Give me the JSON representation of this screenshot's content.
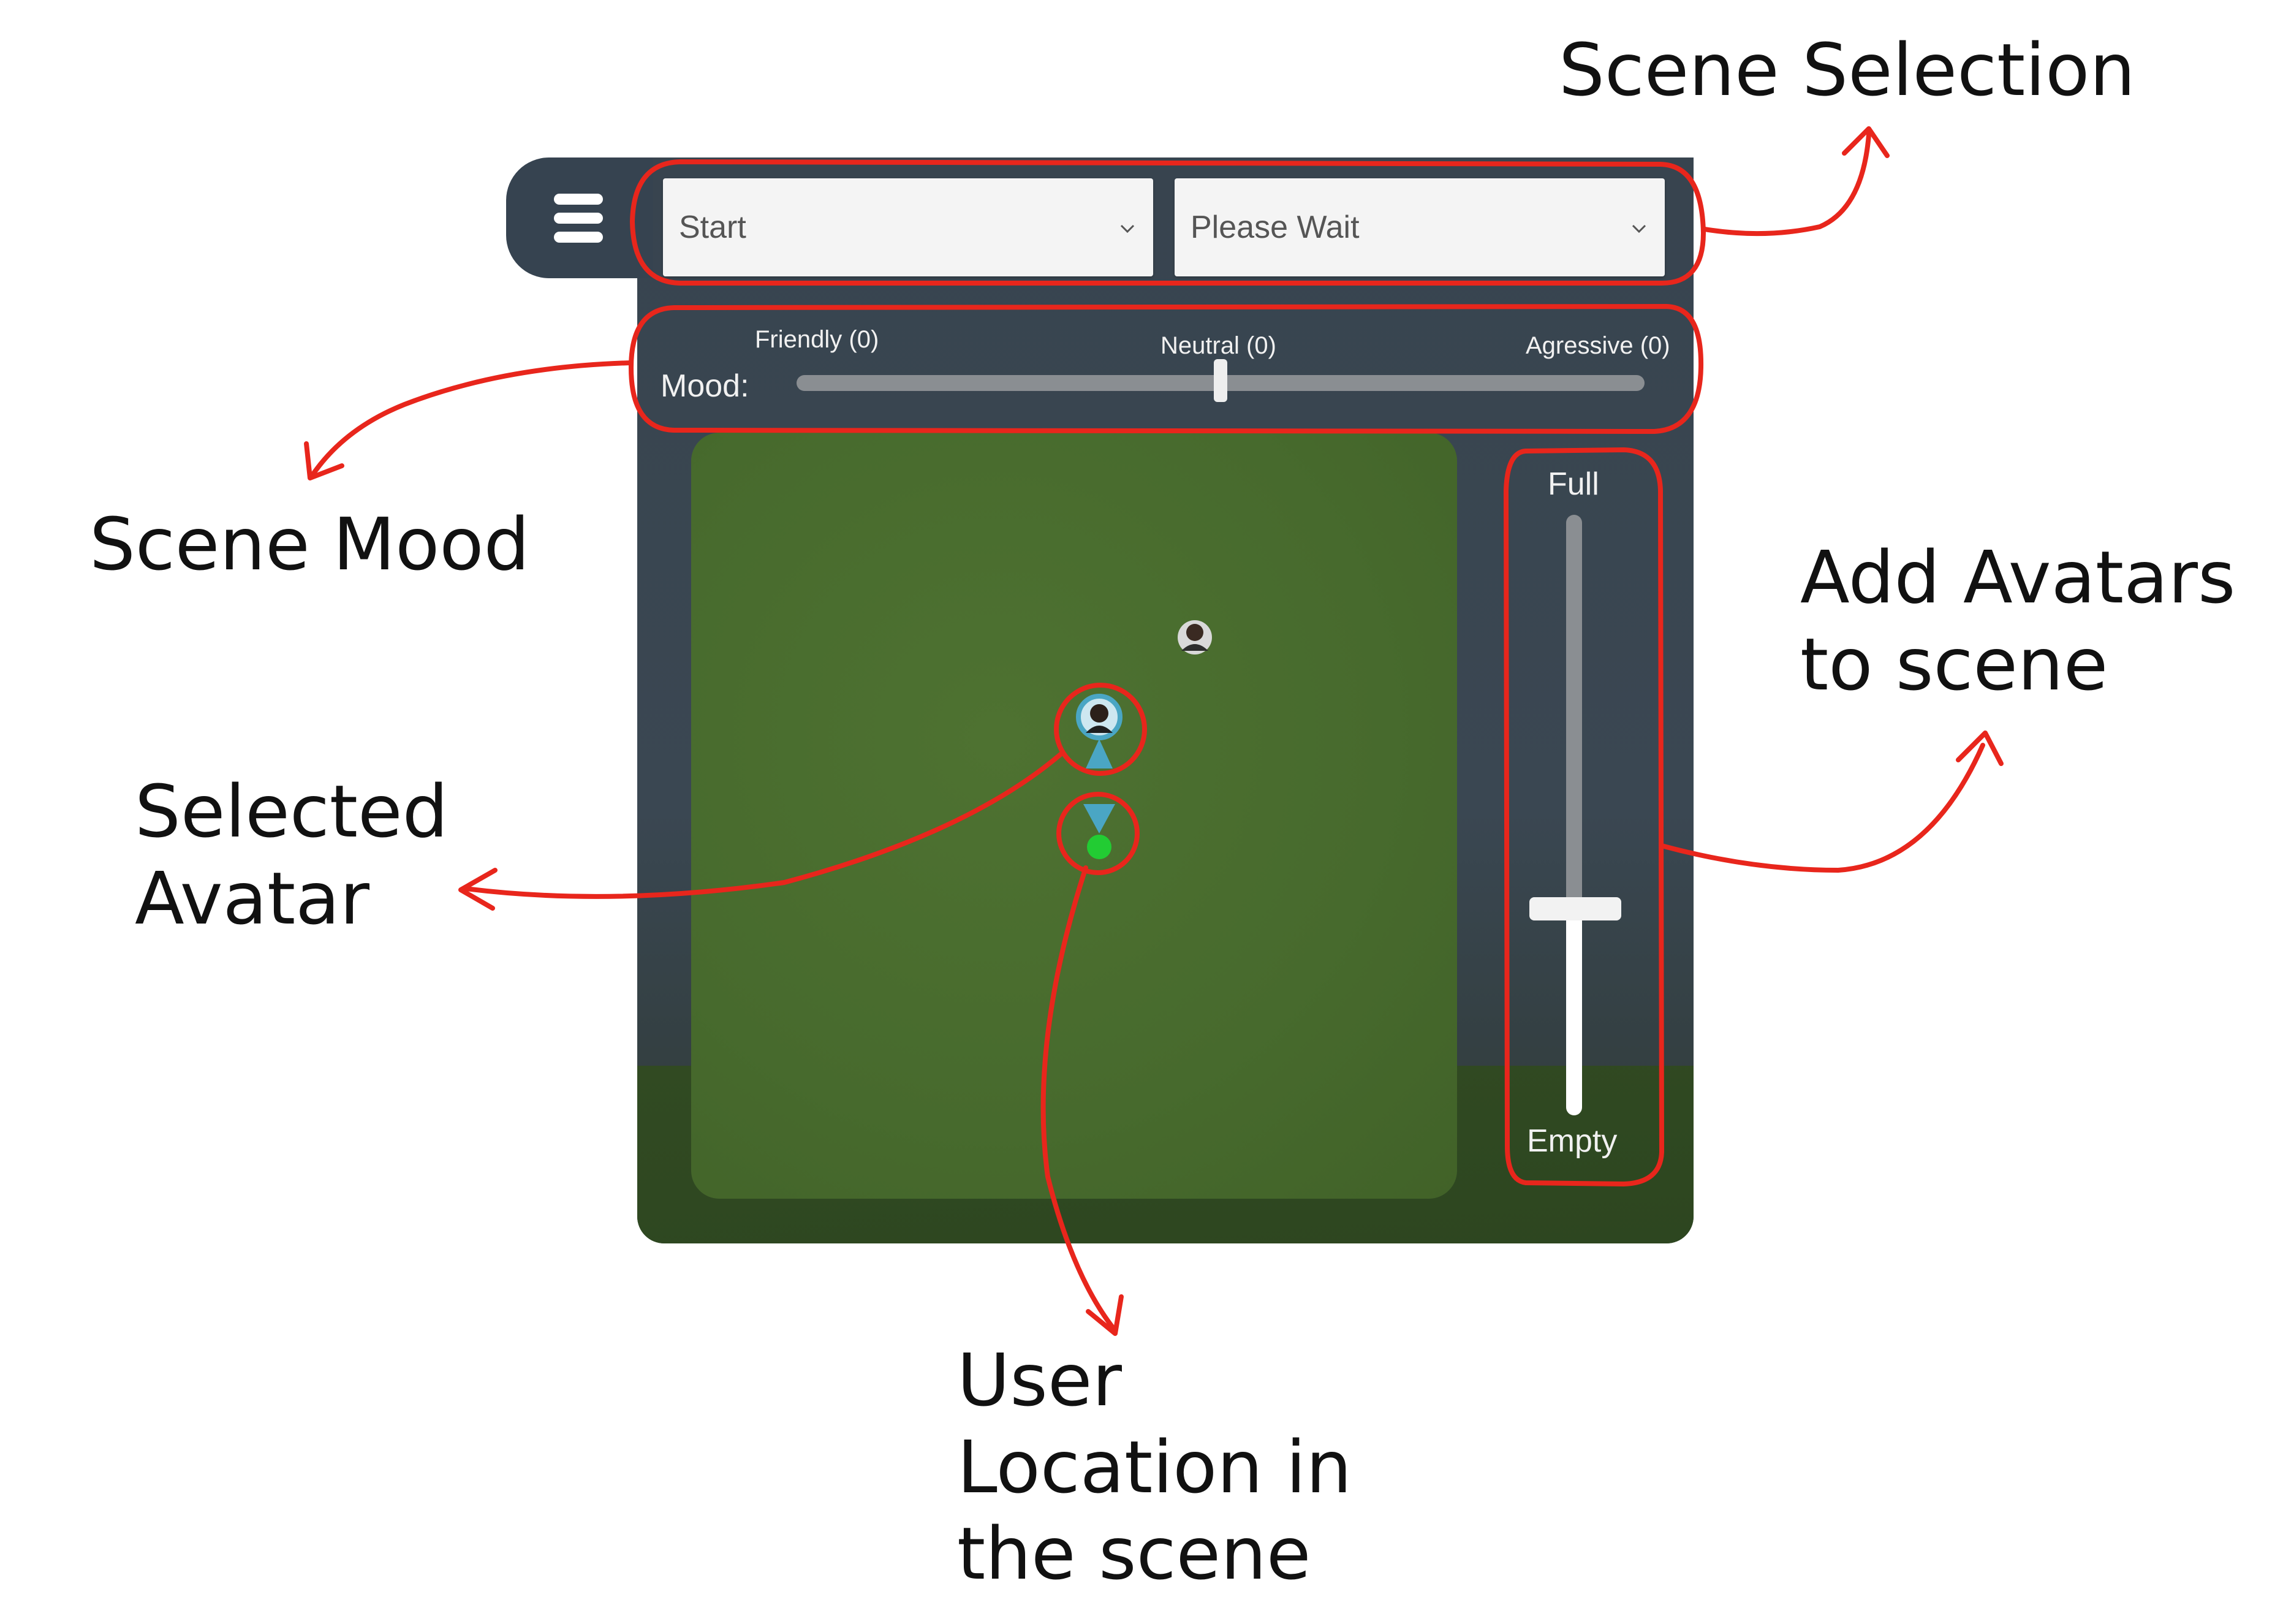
{
  "menu": {
    "icon": "hamburger-menu-icon"
  },
  "scene_select": {
    "scene": {
      "value": "Start"
    },
    "sub_scene": {
      "value": "Please Wait"
    }
  },
  "mood": {
    "label": "Mood:",
    "friendly": "Friendly (0)",
    "neutral": "Neutral (0)",
    "aggressive": "Agressive (0)",
    "level": 0.5
  },
  "avatar_fill": {
    "top_label": "Full",
    "bottom_label": "Empty",
    "level": 0.32
  },
  "annotations": {
    "scene_selection": "Scene Selection",
    "scene_mood": "Scene Mood",
    "selected_avatar_line1": "Selected",
    "selected_avatar_line2": "Avatar",
    "add_avatars_line1": "Add Avatars",
    "add_avatars_line2": "to scene",
    "user_location_line1": "User",
    "user_location_line2": "Location in",
    "user_location_line3": "the scene"
  },
  "colors": {
    "annotation_red": "#e8261c",
    "panel": "#38444f",
    "grass": "#4a6c2e",
    "marker_cone": "#4aa6c4",
    "user_dot": "#22cc33"
  }
}
